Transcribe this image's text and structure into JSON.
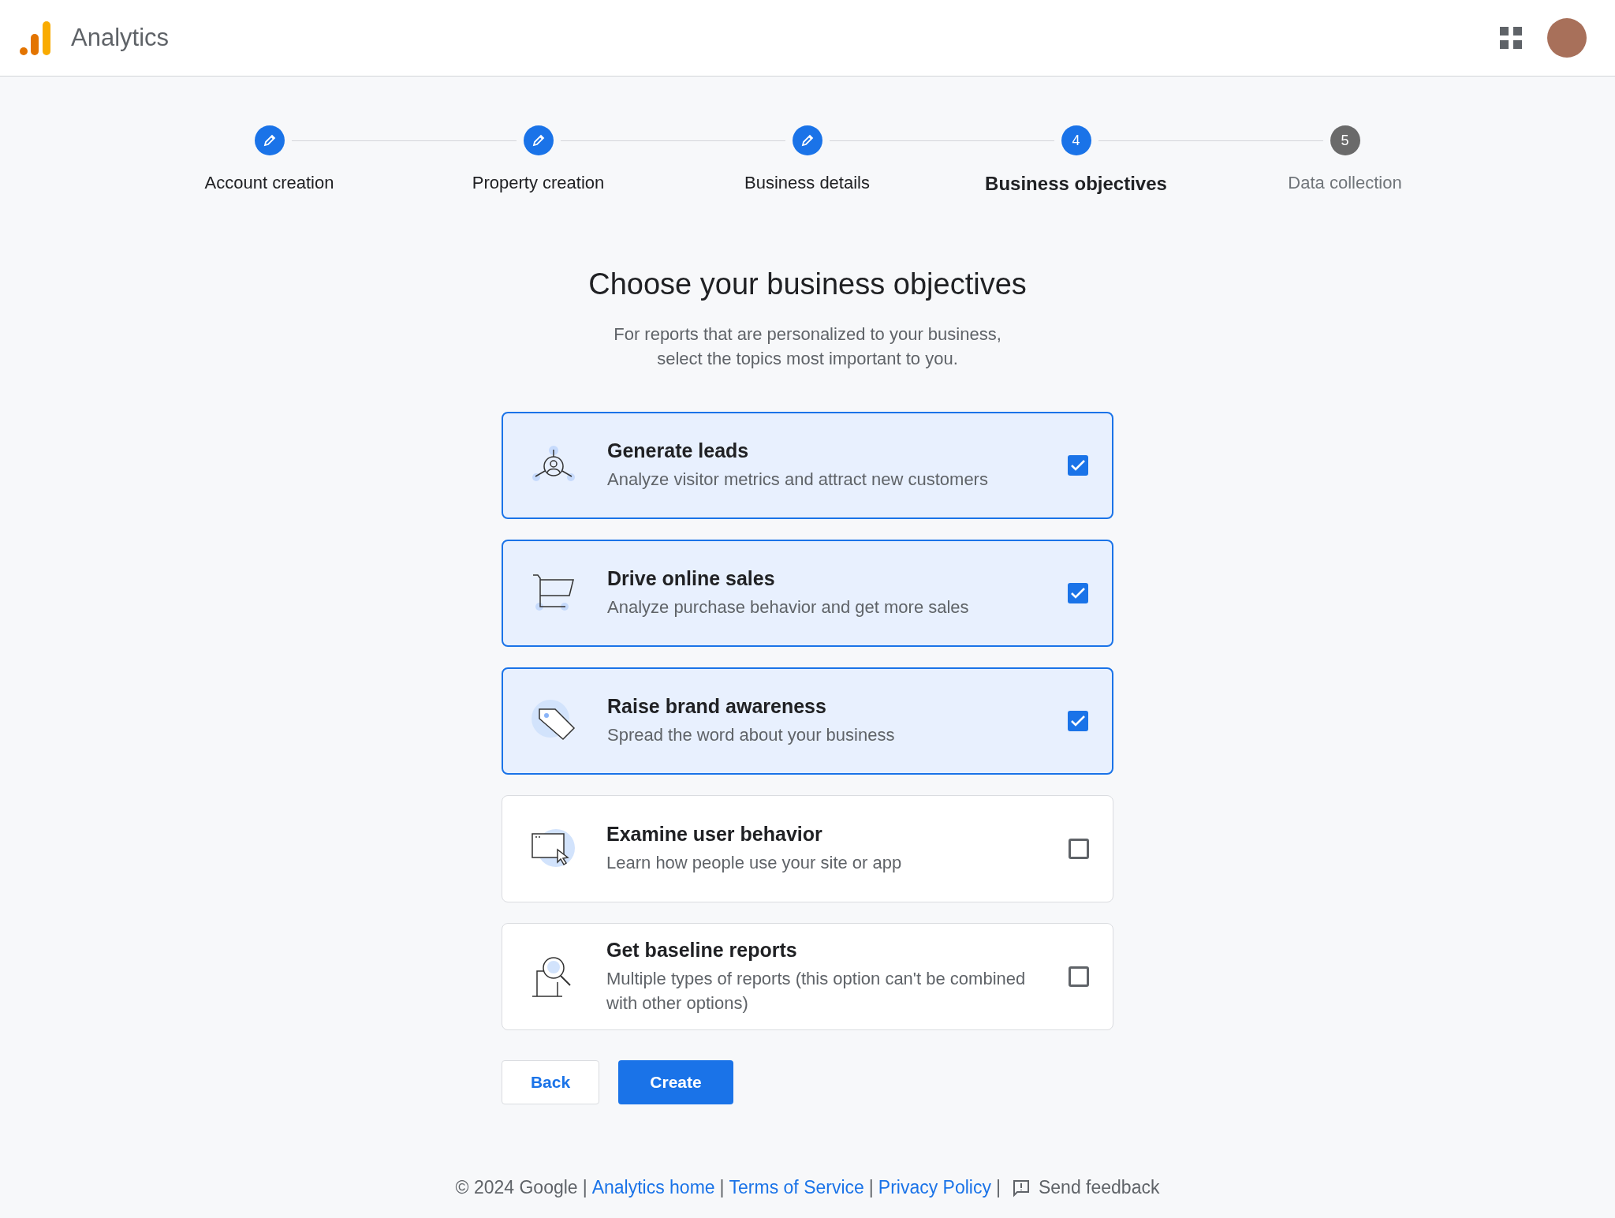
{
  "header": {
    "product": "Analytics"
  },
  "steps": [
    {
      "label": "Account creation",
      "completed": true,
      "selected": false
    },
    {
      "label": "Property creation",
      "completed": true,
      "selected": false
    },
    {
      "label": "Business details",
      "completed": true,
      "selected": false
    },
    {
      "label": "Business objectives",
      "completed": false,
      "selected": true,
      "number": "4"
    },
    {
      "label": "Data collection",
      "completed": false,
      "selected": false,
      "number": "5"
    }
  ],
  "title": "Choose your business objectives",
  "subtitle": [
    "For reports that are personalized to your business,",
    "select the topics most important to you."
  ],
  "objectives": [
    {
      "kind": "leads",
      "title": "Generate leads",
      "description": "Analyze visitor metrics and attract new customers",
      "checked": true
    },
    {
      "kind": "sales",
      "title": "Drive online sales",
      "description": "Analyze purchase behavior and get more sales",
      "checked": true
    },
    {
      "kind": "brand",
      "title": "Raise brand awareness",
      "description": "Spread the word about your business",
      "checked": true
    },
    {
      "kind": "behavior",
      "title": "Examine user behavior",
      "description": "Learn how people use your site or app",
      "checked": false
    },
    {
      "kind": "baseline",
      "title": "Get baseline reports",
      "description": "Multiple types of reports (this option can't be combined with other options)",
      "checked": false
    }
  ],
  "buttons": {
    "back": "Back",
    "create": "Create"
  },
  "footer": {
    "copyright": "© 2024 Google",
    "links": [
      "Analytics home",
      "Terms of Service",
      "Privacy Policy"
    ],
    "separator": "|",
    "feedback": "Send feedback"
  }
}
